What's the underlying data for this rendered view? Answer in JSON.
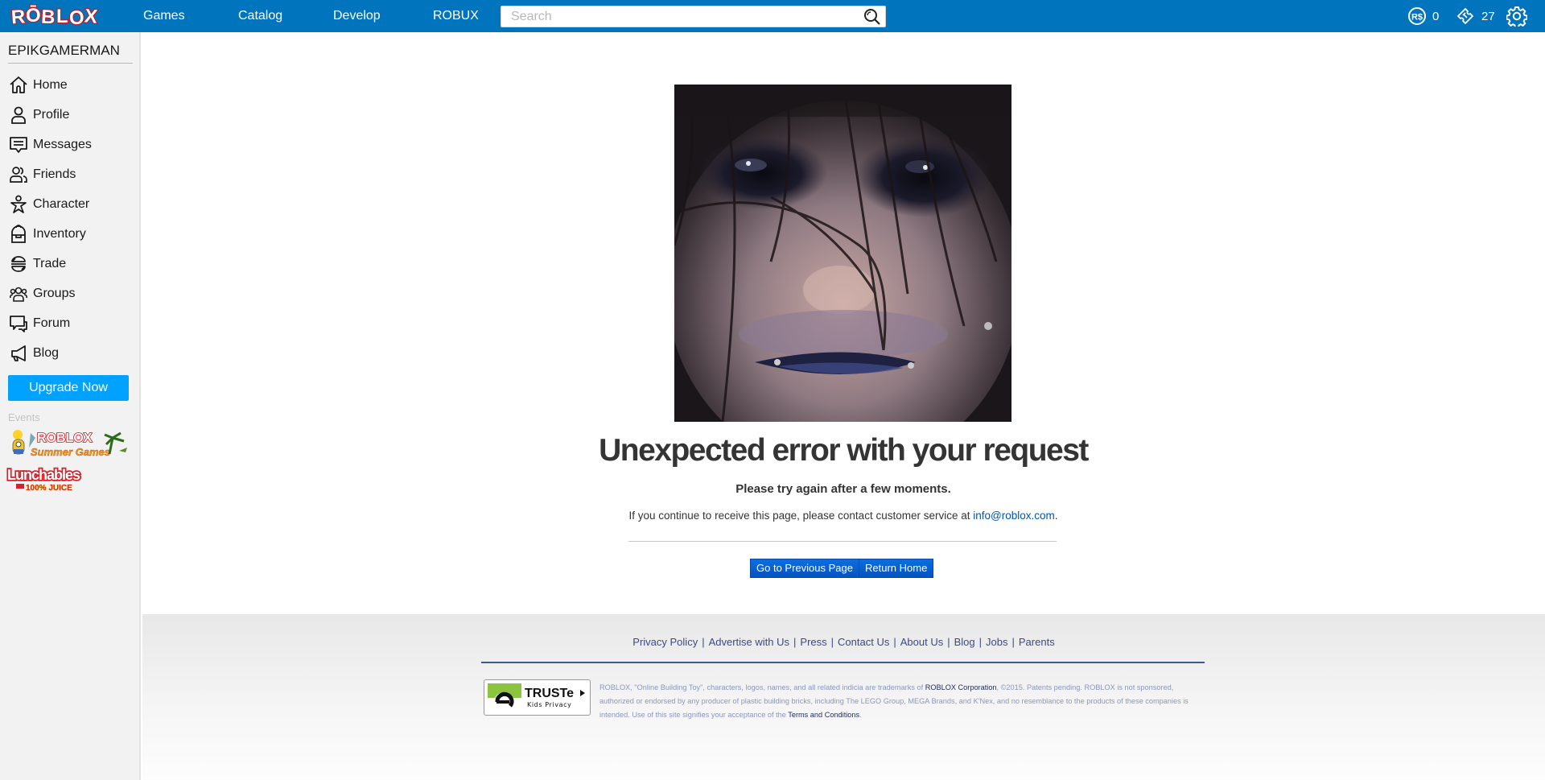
{
  "header": {
    "logo_text": "ROBLOX",
    "nav": [
      {
        "label": "Games"
      },
      {
        "label": "Catalog"
      },
      {
        "label": "Develop"
      },
      {
        "label": "ROBUX"
      }
    ],
    "search": {
      "placeholder": "Search",
      "value": ""
    },
    "robux": {
      "icon": "robux-icon",
      "count": "0"
    },
    "tickets": {
      "icon": "ticket-icon",
      "count": "27"
    },
    "settings_icon": "gear-icon"
  },
  "sidebar": {
    "username": "EPIKGAMERMAN",
    "items": [
      {
        "label": "Home",
        "icon": "home-icon"
      },
      {
        "label": "Profile",
        "icon": "profile-icon"
      },
      {
        "label": "Messages",
        "icon": "messages-icon"
      },
      {
        "label": "Friends",
        "icon": "friends-icon"
      },
      {
        "label": "Character",
        "icon": "character-icon"
      },
      {
        "label": "Inventory",
        "icon": "inventory-icon"
      },
      {
        "label": "Trade",
        "icon": "trade-icon"
      },
      {
        "label": "Groups",
        "icon": "groups-icon"
      },
      {
        "label": "Forum",
        "icon": "forum-icon"
      },
      {
        "label": "Blog",
        "icon": "blog-icon"
      }
    ],
    "upgrade_label": "Upgrade Now",
    "events_label": "Events",
    "events": [
      {
        "title": "ROBLOX",
        "subtitle": "Summer Games"
      },
      {
        "title": "Lunchables",
        "subtitle": "100% JUICE"
      }
    ]
  },
  "main": {
    "title": "Unexpected error with your request",
    "subtitle": "Please try again after a few moments.",
    "info_prefix": "If you continue to receive this page, please contact customer service at ",
    "info_email": "info@roblox.com",
    "info_suffix": ".",
    "buttons": {
      "previous": "Go to Previous Page",
      "home": "Return Home"
    }
  },
  "footer": {
    "links": [
      "Privacy Policy",
      "Advertise with Us",
      "Press",
      "Contact Us",
      "About Us",
      "Blog",
      "Jobs",
      "Parents"
    ],
    "truste": {
      "name": "TRUSTe",
      "sub": "Kids Privacy"
    },
    "legal_part1": "ROBLOX, \"Online Building Toy\", characters, logos, names, and all related indicia are trademarks of ",
    "legal_corp": "ROBLOX Corporation",
    "legal_part2": ", ©2015. Patents pending. ROBLOX is not sponsored, authorized or endorsed by any producer of plastic building bricks, including The LEGO Group, MEGA Brands, and K'Nex, and no resemblance to the products of these companies is intended. Use of this site signifies your acceptance of the ",
    "legal_terms": "Terms and Conditions",
    "legal_end": "."
  },
  "colors": {
    "header_bg": "#0074bd",
    "upgrade_bg": "#00a2ff",
    "button_blue": "#0552c0",
    "link_blue": "#0055b3",
    "footer_link": "#3a4a87"
  }
}
